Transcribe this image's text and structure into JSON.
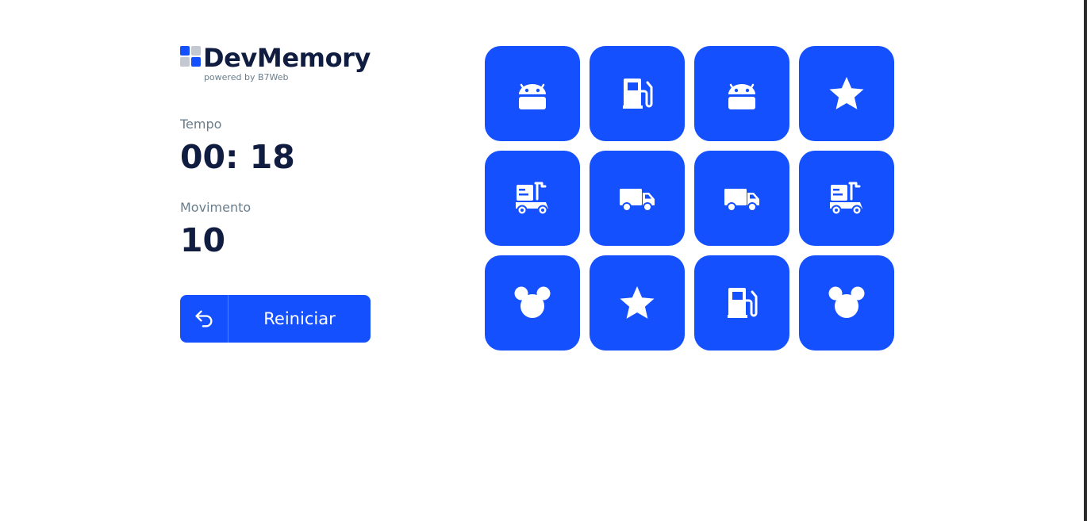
{
  "app": {
    "title": "DevMemory",
    "subtitle": "powered by B7Web"
  },
  "colors": {
    "brand": "#1550FF",
    "dark": "#101C40",
    "muted": "#6A7D8B"
  },
  "stats": {
    "time_label": "Tempo",
    "time_value": "00: 18",
    "moves_label": "Movimento",
    "moves_value": "10"
  },
  "reset": {
    "label": "Reiniciar",
    "icon": "undo-icon"
  },
  "board": {
    "cards": [
      {
        "icon": "android-icon",
        "revealed": true
      },
      {
        "icon": "gas-station-icon",
        "revealed": true
      },
      {
        "icon": "android-icon",
        "revealed": true
      },
      {
        "icon": "star-icon",
        "revealed": true
      },
      {
        "icon": "scooter-icon",
        "revealed": true
      },
      {
        "icon": "truck-icon",
        "revealed": true
      },
      {
        "icon": "truck-icon",
        "revealed": true
      },
      {
        "icon": "scooter-icon",
        "revealed": true
      },
      {
        "icon": "mouse-ears-icon",
        "revealed": true
      },
      {
        "icon": "star-icon",
        "revealed": true
      },
      {
        "icon": "gas-station-icon",
        "revealed": true
      },
      {
        "icon": "mouse-ears-icon",
        "revealed": true
      }
    ]
  }
}
